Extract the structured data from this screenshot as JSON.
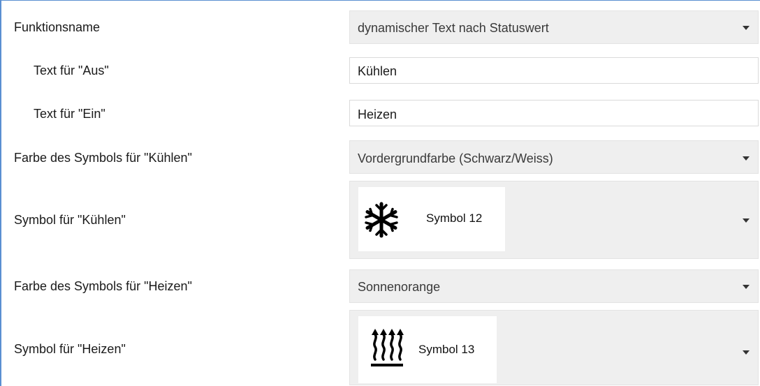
{
  "rows": [
    {
      "label": "Funktionsname",
      "value": "dynamischer Text nach Statuswert"
    },
    {
      "label": "Text für \"Aus\"",
      "value": "Kühlen"
    },
    {
      "label": "Text für \"Ein\"",
      "value": "Heizen"
    },
    {
      "label": "Farbe des Symbols für \"Kühlen\"",
      "value": "Vordergrundfarbe (Schwarz/Weiss)"
    },
    {
      "label": "Symbol für \"Kühlen\"",
      "value": "Symbol 12",
      "icon": "snowflake-icon"
    },
    {
      "label": "Farbe des Symbols für \"Heizen\"",
      "value": "Sonnenorange"
    },
    {
      "label": "Symbol für \"Heizen\"",
      "value": "Symbol 13",
      "icon": "heating-icon"
    }
  ],
  "colors": {
    "frame_border": "#5a8fd1",
    "select_bg": "#efefef",
    "input_bg": "#ffffff"
  }
}
